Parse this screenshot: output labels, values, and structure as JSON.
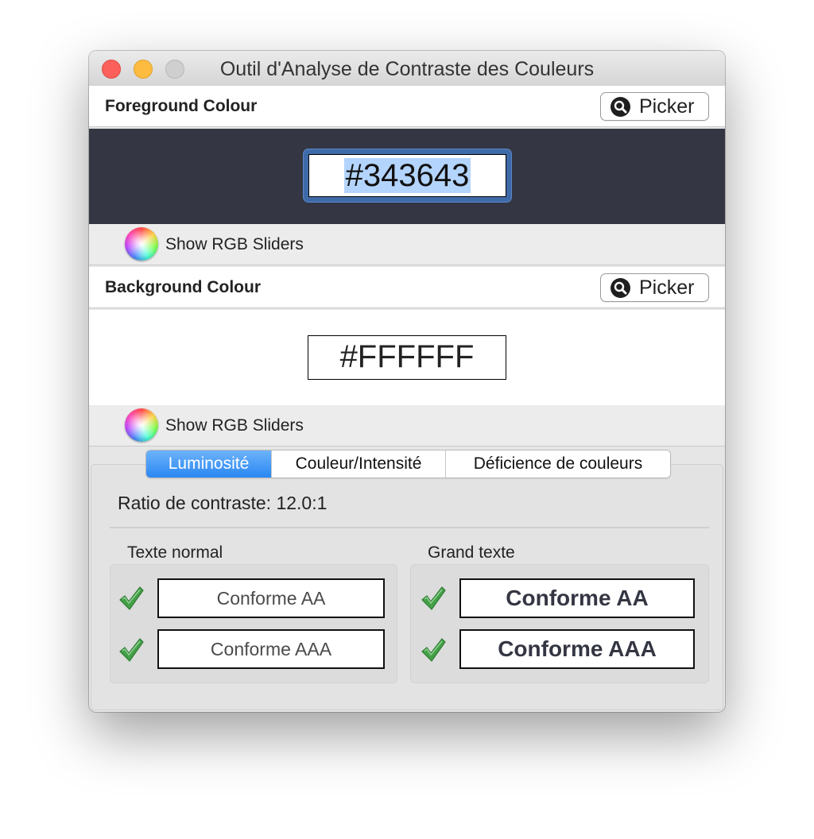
{
  "window": {
    "title": "Outil d'Analyse de Contraste des Couleurs"
  },
  "foreground": {
    "label": "Foreground Colour",
    "picker_label": "Picker",
    "hex_value": "#343643",
    "swatch_color": "#343643",
    "rgb_sliders_label": "Show RGB Sliders"
  },
  "background": {
    "label": "Background Colour",
    "picker_label": "Picker",
    "hex_value": "#FFFFFF",
    "swatch_color": "#FFFFFF",
    "rgb_sliders_label": "Show RGB Sliders"
  },
  "tabs": [
    {
      "label": "Luminosité",
      "active": true
    },
    {
      "label": "Couleur/Intensité",
      "active": false
    },
    {
      "label": "Déficience de couleurs",
      "active": false
    }
  ],
  "results": {
    "contrast_ratio_text": "Ratio de contraste: 12.0:1",
    "normal_text": {
      "heading": "Texte normal",
      "aa": "Conforme AA",
      "aaa": "Conforme AAA"
    },
    "large_text": {
      "heading": "Grand texte",
      "aa": "Conforme AA",
      "aaa": "Conforme AAA"
    }
  },
  "icons": {
    "search": "magnifier-icon",
    "color_wheel": "color-wheel-icon",
    "check": "check-icon"
  },
  "colors": {
    "accent": "#2a87f3",
    "check_green": "#3a9b3e",
    "close": "#fc605b",
    "minimize": "#fdbc40",
    "zoom_disabled": "#cfcfcf"
  }
}
